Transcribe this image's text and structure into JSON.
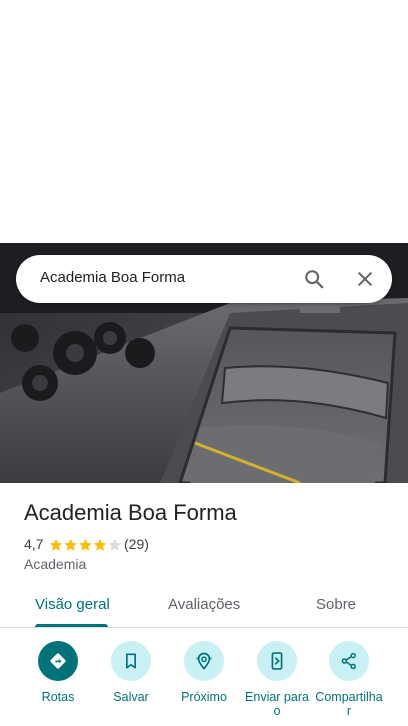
{
  "search": {
    "query": "Academia Boa Forma"
  },
  "place": {
    "name": "Academia Boa Forma",
    "rating": "4,7",
    "stars": 4.7,
    "review_count": "(29)",
    "category": "Academia"
  },
  "tabs": [
    {
      "label": "Visão geral",
      "active": true
    },
    {
      "label": "Avaliações",
      "active": false
    },
    {
      "label": "Sobre",
      "active": false
    }
  ],
  "actions": [
    {
      "label": "Rotas",
      "icon": "directions-icon"
    },
    {
      "label": "Salvar",
      "icon": "bookmark-icon"
    },
    {
      "label": "Próximo",
      "icon": "nearby-icon"
    },
    {
      "label": "Enviar para o",
      "icon": "send-to-phone-icon"
    },
    {
      "label": "Compartilhar",
      "icon": "share-icon"
    }
  ],
  "colors": {
    "accent": "#00737a",
    "action_bg": "#c9f0f4",
    "star": "#fbbc04"
  }
}
